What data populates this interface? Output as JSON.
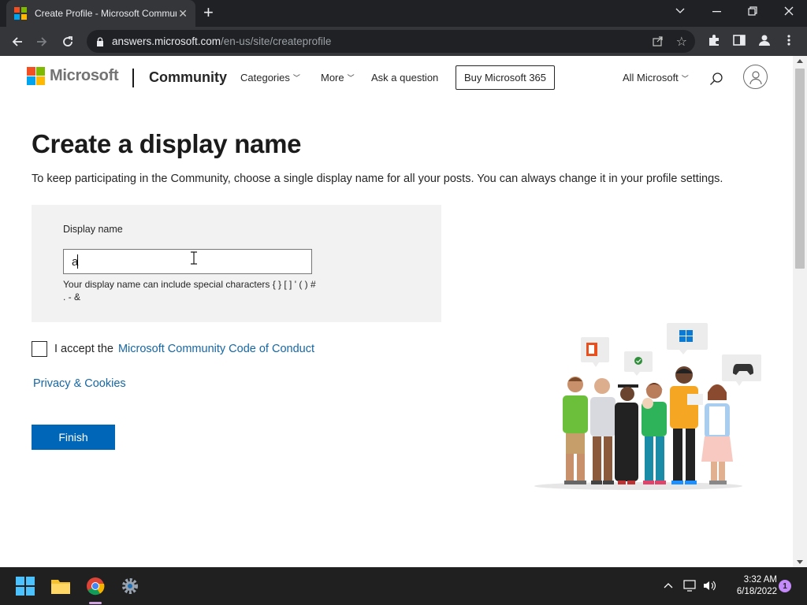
{
  "browser": {
    "tab_title": "Create Profile - Microsoft Community",
    "url_host": "answers.microsoft.com",
    "url_path": "/en-us/site/createprofile"
  },
  "header": {
    "brand": "Microsoft",
    "community": "Community",
    "nav": {
      "categories": "Categories",
      "more": "More",
      "ask": "Ask a question"
    },
    "buy_label": "Buy Microsoft 365",
    "all_microsoft": "All Microsoft"
  },
  "main": {
    "title": "Create a display name",
    "description": "To keep participating in the Community, choose a single display name for all your posts. You can always change it in your profile settings.",
    "form": {
      "label": "Display name",
      "value": "a",
      "hint": "Your display name can include special characters { } [ ] ' ( ) # . - &"
    },
    "accept_text": "I accept the",
    "coc_link": "Microsoft Community Code of Conduct",
    "privacy_link": "Privacy & Cookies",
    "finish_label": "Finish"
  },
  "taskbar": {
    "time": "3:32 AM",
    "date": "6/18/2022",
    "notification_count": "1"
  },
  "colors": {
    "accent": "#0067b8",
    "link": "#1467a6",
    "ms_red": "#f25022",
    "ms_green": "#7fba00",
    "ms_blue": "#00a4ef",
    "ms_yellow": "#ffb900"
  }
}
